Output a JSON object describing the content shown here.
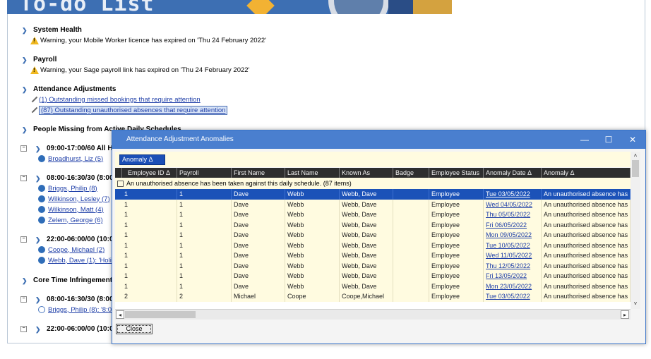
{
  "banner": {
    "title": "To-do  List"
  },
  "sections": {
    "system_health": {
      "title": "System Health",
      "items": [
        "Warning, your Mobile Worker licence has expired on 'Thu 24 February 2022'"
      ]
    },
    "payroll": {
      "title": "Payroll",
      "items": [
        "Warning, your Sage payroll link has expired on 'Thu 24 February 2022'"
      ]
    },
    "attendance": {
      "title": "Attendance Adjustments",
      "items": [
        "(1) Outstanding missed bookings that require attention",
        "(87) Outstanding unauthorised absences that require attention"
      ]
    },
    "missing": {
      "title": "People Missing from Active Daily Schedules"
    },
    "core_time": {
      "title": "Core Time Infringement"
    }
  },
  "schedules": [
    {
      "label": "09:00-17:00/60 All H",
      "people": [
        "Broadhurst, Liz (5)"
      ]
    },
    {
      "label": "08:00-16:30/30 (8:00",
      "people": [
        "Briggs, Philip (8)",
        "Wilkinson, Lesley (7)",
        "Wilkinson, Matt (4)",
        "Zelem, George (6)"
      ]
    },
    {
      "label": "22:00-06:00/00 (10:0",
      "people": [
        "Coope, Michael (2)",
        "Webb, Dave (1): 'Holid"
      ]
    }
  ],
  "core_schedules": [
    {
      "label": "08:00-16:30/30 (8:00",
      "people": [
        "Briggs, Philip (8): '8:064"
      ]
    },
    {
      "label": "22:00-06:00/00 (10:0",
      "people": []
    }
  ],
  "dialog": {
    "title": "Attendance Adjustment Anomalies",
    "group_chip": "Anomaly Δ",
    "columns": [
      "Employee ID Δ",
      "Payroll",
      "First Name",
      "Last Name",
      "Known As",
      "Badge",
      "Employee Status",
      "Anomaly Date Δ",
      "Anomaly Δ"
    ],
    "group_row": "An unauthorised absence has been taken against this daily schedule. (87 items)",
    "rows": [
      [
        "1",
        "1",
        "Dave",
        "Webb",
        "Webb, Dave",
        "",
        "Employee",
        "Tue 03/05/2022",
        "An unauthorised absence has b..."
      ],
      [
        "1",
        "1",
        "Dave",
        "Webb",
        "Webb, Dave",
        "",
        "Employee",
        "Wed 04/05/2022",
        "An unauthorised absence has b..."
      ],
      [
        "1",
        "1",
        "Dave",
        "Webb",
        "Webb, Dave",
        "",
        "Employee",
        "Thu 05/05/2022",
        "An unauthorised absence has b..."
      ],
      [
        "1",
        "1",
        "Dave",
        "Webb",
        "Webb, Dave",
        "",
        "Employee",
        "Fri 06/05/2022",
        "An unauthorised absence has b..."
      ],
      [
        "1",
        "1",
        "Dave",
        "Webb",
        "Webb, Dave",
        "",
        "Employee",
        "Mon 09/05/2022",
        "An unauthorised absence has b..."
      ],
      [
        "1",
        "1",
        "Dave",
        "Webb",
        "Webb, Dave",
        "",
        "Employee",
        "Tue 10/05/2022",
        "An unauthorised absence has b..."
      ],
      [
        "1",
        "1",
        "Dave",
        "Webb",
        "Webb, Dave",
        "",
        "Employee",
        "Wed 11/05/2022",
        "An unauthorised absence has b..."
      ],
      [
        "1",
        "1",
        "Dave",
        "Webb",
        "Webb, Dave",
        "",
        "Employee",
        "Thu 12/05/2022",
        "An unauthorised absence has b..."
      ],
      [
        "1",
        "1",
        "Dave",
        "Webb",
        "Webb, Dave",
        "",
        "Employee",
        "Fri 13/05/2022",
        "An unauthorised absence has b..."
      ],
      [
        "1",
        "1",
        "Dave",
        "Webb",
        "Webb, Dave",
        "",
        "Employee",
        "Mon 23/05/2022",
        "An unauthorised absence has b..."
      ],
      [
        "2",
        "2",
        "Michael",
        "Coope",
        "Coope,Michael",
        "",
        "Employee",
        "Tue 03/05/2022",
        "An unauthorised absence has b..."
      ]
    ],
    "close_label": "Close"
  }
}
